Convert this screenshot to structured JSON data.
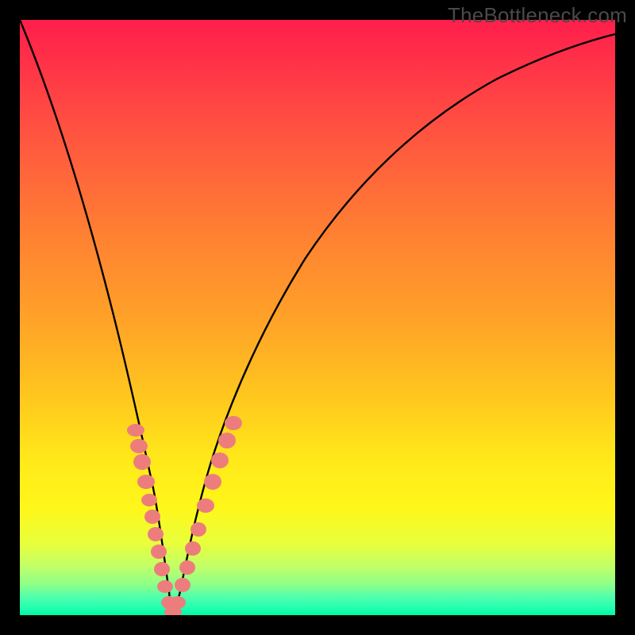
{
  "watermark": "TheBottleneck.com",
  "colors": {
    "frame": "#000000",
    "curve": "#000000",
    "markers": "#ed7d7d",
    "gradient_top": "#ff1e4c",
    "gradient_bottom": "#00f8a4"
  },
  "chart_data": {
    "type": "line",
    "title": "",
    "xlabel": "",
    "ylabel": "",
    "xlim": [
      0,
      100
    ],
    "ylim": [
      0,
      100
    ],
    "series": [
      {
        "name": "bottleneck-curve",
        "x": [
          0,
          2,
          4,
          6,
          8,
          10,
          12,
          14,
          16,
          18,
          20,
          22,
          24,
          25,
          26,
          28,
          30,
          32,
          35,
          40,
          45,
          50,
          55,
          60,
          65,
          70,
          75,
          80,
          85,
          90,
          95,
          100
        ],
        "y": [
          100,
          92,
          84,
          76,
          68,
          60,
          52,
          44,
          36,
          27,
          18,
          9,
          2,
          0,
          2,
          8,
          15,
          22,
          31,
          43,
          53,
          61,
          68,
          73,
          78,
          82,
          85,
          88,
          90,
          92,
          94,
          95
        ]
      }
    ],
    "markers": [
      {
        "x": 18.5,
        "y": 30
      },
      {
        "x": 19.0,
        "y": 27
      },
      {
        "x": 19.5,
        "y": 24
      },
      {
        "x": 20.5,
        "y": 19
      },
      {
        "x": 21.0,
        "y": 16
      },
      {
        "x": 21.5,
        "y": 13
      },
      {
        "x": 22.0,
        "y": 10
      },
      {
        "x": 22.7,
        "y": 7
      },
      {
        "x": 23.3,
        "y": 4
      },
      {
        "x": 24.0,
        "y": 1.5
      },
      {
        "x": 25.0,
        "y": 0.3
      },
      {
        "x": 26.0,
        "y": 1.5
      },
      {
        "x": 26.7,
        "y": 4
      },
      {
        "x": 27.5,
        "y": 7
      },
      {
        "x": 28.2,
        "y": 10
      },
      {
        "x": 29.0,
        "y": 13
      },
      {
        "x": 30.5,
        "y": 19
      },
      {
        "x": 31.5,
        "y": 22
      },
      {
        "x": 32.5,
        "y": 26
      },
      {
        "x": 33.5,
        "y": 29
      }
    ],
    "minimum_at": 25
  }
}
